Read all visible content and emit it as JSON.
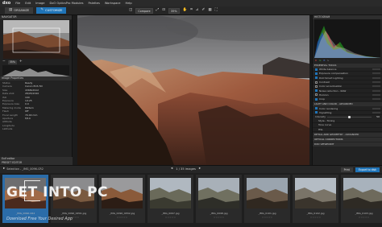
{
  "app": {
    "logo": "dxo",
    "menu": [
      "File",
      "Edit",
      "Image",
      "DxO OpticsPro Modules",
      "Palettes",
      "Workspace",
      "Help"
    ]
  },
  "toolbar": {
    "tabs": [
      "ORGANIZE",
      "CUSTOMIZE"
    ],
    "compare_label": "Compare",
    "zoom_value": "35%"
  },
  "navigator": {
    "title": "NAVIGATOR",
    "zoom_value": "35%"
  },
  "image_properties": {
    "title": "Image Properties",
    "rows": [
      {
        "k": "Status",
        "v": "Ready"
      },
      {
        "k": "Camera",
        "v": "Canon EOS 5D"
      },
      {
        "k": "Size",
        "v": "4368x2912"
      },
      {
        "k": "Date shot",
        "v": "28/05/2010"
      },
      {
        "k": "ISO",
        "v": "100"
      },
      {
        "k": "Exposure",
        "v": "1/125"
      },
      {
        "k": "Exposure bias",
        "v": "0.0"
      },
      {
        "k": "Metering mode",
        "v": "Pattern"
      },
      {
        "k": "Flash",
        "v": "Off"
      },
      {
        "k": "Focal Length",
        "v": "70.00 mm"
      },
      {
        "k": "Aperture",
        "v": "f/8.0"
      },
      {
        "k": "Altitude",
        "v": ""
      },
      {
        "k": "Longitude",
        "v": ""
      },
      {
        "k": "Latitude",
        "v": ""
      }
    ],
    "exif_title": "Exif editor",
    "preset_title": "PRESET EDITOR"
  },
  "right_panel": {
    "histogram_title": "HISTOGRAM",
    "rgb": [
      "R",
      "G",
      "B",
      "L"
    ],
    "essential_title": "ESSENTIAL TOOLS",
    "tools": [
      {
        "label": "White balance",
        "on": true
      },
      {
        "label": "Exposure compensation",
        "on": true
      },
      {
        "label": "DxO Smart Lighting",
        "on": true
      },
      {
        "label": "Contrast",
        "on": false
      },
      {
        "label": "Color accentuation",
        "on": false
      },
      {
        "label": "Noise reduction - RAW",
        "on": true
      },
      {
        "label": "Horizon",
        "on": false
      },
      {
        "label": "Crop",
        "on": true
      }
    ],
    "light_title": "LIGHT AND COLOR - ADVANCED",
    "light_tools": [
      {
        "label": "Color rendering",
        "on": true
      },
      {
        "label": "Vignetting",
        "on": true
      }
    ],
    "intensity_label": "Intensity",
    "intensity_value": "50",
    "style_rows": [
      "Style - Toning",
      "Tone curve",
      "HSL"
    ],
    "sections": [
      "DETAIL AND GEOMETRY - ADVANCED",
      "OPTICAL CORRECTIONS",
      "DXO VIEWPOINT"
    ]
  },
  "lowbar": {
    "selection": "Selection - _IMG_0096-CR2",
    "counter": "1 / 35 images",
    "print_label": "Print",
    "export_label": "Export to disk"
  },
  "filmstrip": {
    "frames": [
      {
        "caption": "_IMG_0096.CR2"
      },
      {
        "caption": "_IMG_0096_OP01.jpg"
      },
      {
        "caption": "_IMG_0096_OP02.jpg"
      },
      {
        "caption": "_IMG_0097.jpg"
      },
      {
        "caption": "_IMG_0098.jpg"
      },
      {
        "caption": "_IMG_0101.jpg"
      },
      {
        "caption": "_IMG_0102.jpg"
      },
      {
        "caption": "_IMG_0103.jpg"
      }
    ]
  },
  "watermark": {
    "text": "GET INTO PC",
    "subtitle": "Download Free Your Desired App"
  },
  "colors": {
    "accent": "#1f74b8"
  }
}
